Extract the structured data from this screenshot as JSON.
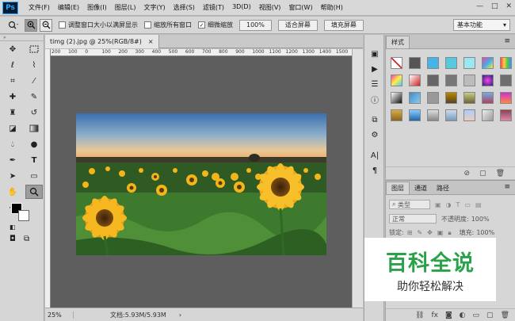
{
  "app": {
    "logo": "Ps"
  },
  "menu": [
    "文件(F)",
    "编辑(E)",
    "图像(I)",
    "图层(L)",
    "文字(Y)",
    "选择(S)",
    "滤镜(T)",
    "3D(D)",
    "视图(V)",
    "窗口(W)",
    "帮助(H)"
  ],
  "window_controls": {
    "minimize": "—",
    "maximize": "□",
    "close": "✕"
  },
  "options": {
    "check_resize": "调整窗口大小以满屏显示",
    "check_zoom_all": "缩放所有窗口",
    "check_scrubby": "细微缩放",
    "zoom_value": "100%",
    "fit_screen": "适合屏幕",
    "fill_screen": "填充屏幕",
    "workspace": "基本功能"
  },
  "document": {
    "tab_title": "timg (2).jpg @ 25%(RGB/8#)",
    "tab_close": "×",
    "ruler_ticks": [
      "200",
      "100",
      "0",
      "100",
      "200",
      "300",
      "400",
      "500",
      "600",
      "700",
      "800",
      "900",
      "1000",
      "1100",
      "1200",
      "1300",
      "1400",
      "1500"
    ]
  },
  "status": {
    "zoom": "25%",
    "doc_info": "文档:5.93M/5.93M",
    "arrow": "›"
  },
  "panels": {
    "styles_tab": "样式",
    "layers_tabs": [
      "图层",
      "通道",
      "路径"
    ],
    "layers_kind": "类型",
    "blend_mode": "正常",
    "opacity_label": "不透明度:",
    "opacity_value": "100%",
    "lock_label": "锁定:",
    "fill_label": "填充:",
    "fill_value": "100%"
  },
  "watermark": {
    "title": "百科全说",
    "subtitle": "助你轻松解决"
  },
  "colors": {
    "accent_green": "#2aa24a",
    "ps_blue": "#31a8ff"
  }
}
